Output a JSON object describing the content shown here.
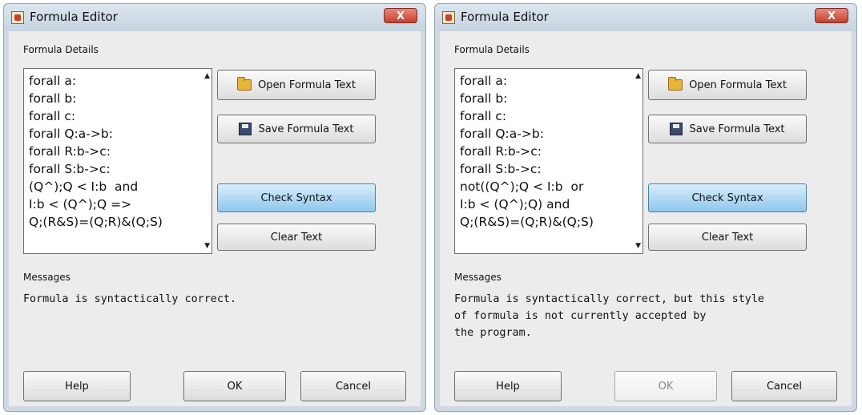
{
  "dialogs": [
    {
      "title": "Formula Editor",
      "close_label": "X",
      "details_label": "Formula Details",
      "formula_text": "forall a:\nforall b:\nforall c:\nforall Q:a->b:\nforall R:b->c:\nforall S:b->c:\n(Q^);Q < I:b  and\nI:b < (Q^);Q =>\nQ;(R&S)=(Q;R)&(Q;S)",
      "open_label": "Open Formula Text",
      "save_label": "Save Formula Text",
      "check_label": "Check Syntax",
      "clear_label": "Clear Text",
      "messages_label": "Messages",
      "messages": [
        "Formula is syntactically correct."
      ],
      "help_label": "Help",
      "ok_label": "OK",
      "cancel_label": "Cancel"
    },
    {
      "title": "Formula Editor",
      "close_label": "X",
      "details_label": "Formula Details",
      "formula_text": "forall a:\nforall b:\nforall c:\nforall Q:a->b:\nforall R:b->c:\nforall S:b->c:\nnot((Q^);Q < I:b  or\nI:b < (Q^);Q) and\nQ;(R&S)=(Q;R)&(Q;S)",
      "open_label": "Open Formula Text",
      "save_label": "Save Formula Text",
      "check_label": "Check Syntax",
      "clear_label": "Clear Text",
      "messages_label": "Messages",
      "messages": [
        "Formula is syntactically correct, but this style",
        "of formula is not currently accepted by",
        "the program."
      ],
      "help_label": "Help",
      "ok_label": "OK",
      "cancel_label": "Cancel"
    }
  ],
  "icons": {
    "app": "java-cup-icon",
    "open": "folder-icon",
    "save": "floppy-disk-icon"
  }
}
